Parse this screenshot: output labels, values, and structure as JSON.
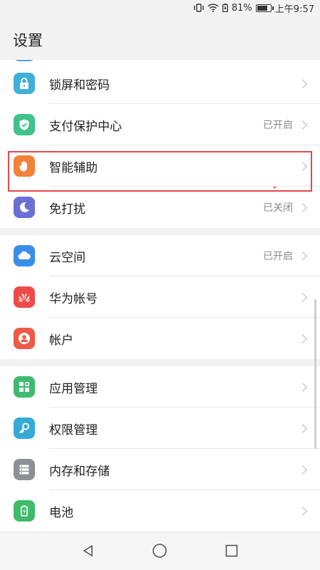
{
  "status": {
    "battery_percent": "81%",
    "time": "上午9:57",
    "battery_level": 0.81
  },
  "header": {
    "title": "设置"
  },
  "groups": [
    {
      "items": [
        {
          "label": "锁屏和密码",
          "value": "",
          "icon": "lock-icon",
          "color": "#3fb0d8"
        },
        {
          "label": "支付保护中心",
          "value": "已开启",
          "icon": "shield-check-icon",
          "color": "#3fc38a"
        },
        {
          "label": "智能辅助",
          "value": "",
          "icon": "hand-icon",
          "color": "#f2813a"
        },
        {
          "label": "免打扰",
          "value": "已关闭",
          "icon": "moon-icon",
          "color": "#6b6fd4"
        }
      ]
    },
    {
      "items": [
        {
          "label": "云空间",
          "value": "已开启",
          "icon": "cloud-icon",
          "color": "#3a8ee8"
        },
        {
          "label": "华为帐号",
          "value": "",
          "icon": "huawei-logo-icon",
          "color": "#ef4a4a"
        },
        {
          "label": "帐户",
          "value": "",
          "icon": "user-icon",
          "color": "#ee5a48"
        }
      ]
    },
    {
      "items": [
        {
          "label": "应用管理",
          "value": "",
          "icon": "apps-grid-icon",
          "color": "#3dbb6f"
        },
        {
          "label": "权限管理",
          "value": "",
          "icon": "key-icon",
          "color": "#36a9d6"
        },
        {
          "label": "内存和存储",
          "value": "",
          "icon": "storage-icon",
          "color": "#8d8f94"
        },
        {
          "label": "电池",
          "value": "",
          "icon": "battery-icon",
          "color": "#3fbb6a"
        }
      ]
    }
  ]
}
